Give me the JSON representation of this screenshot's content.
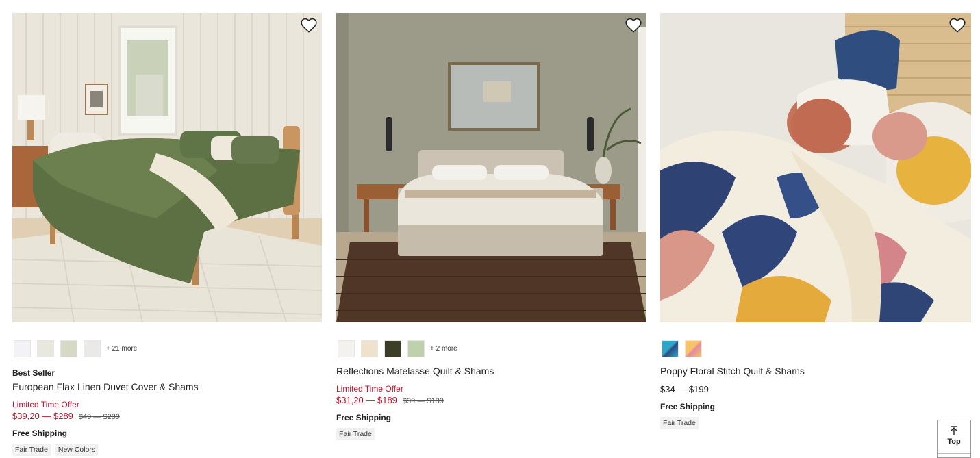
{
  "products": [
    {
      "name": "European Flax Linen Duvet Cover & Shams",
      "badge": "Best Seller",
      "swatches": [
        "#f3f3f7",
        "#e8e8df",
        "#d7d8c5",
        "#ebe9e7"
      ],
      "more_colors": "+ 21 more",
      "offer": "Limited Time Offer",
      "sale_price": "$39,20 — $289",
      "regular_price": "$49 — $289",
      "shipping": "Free Shipping",
      "tags": [
        "Fair Trade",
        "New Colors"
      ]
    },
    {
      "name": "Reflections Matelasse Quilt & Shams",
      "swatches": [
        "#f4f2ee",
        "#efe2cc",
        "#3d3e28",
        "#bfd0ad"
      ],
      "more_colors": "+ 2 more",
      "offer": "Limited Time Offer",
      "sale_price": "$31,20 — $189",
      "regular_price": "$39 — $189",
      "shipping": "Free Shipping",
      "tags": [
        "Fair Trade"
      ]
    },
    {
      "name": "Poppy Floral Stitch Quilt & Shams",
      "swatches": [
        "#2fa6c7",
        "#f5c466"
      ],
      "price": "$34 — $199",
      "shipping": "Free Shipping",
      "tags": [
        "Fair Trade"
      ]
    }
  ],
  "scroll_top": {
    "label": "Top"
  },
  "colors": {
    "sale_red": "#c8102e",
    "tag_bg": "#f1f1f1"
  },
  "icons": {
    "favorite": "heart-icon",
    "scroll_top": "arrow-up-icon"
  }
}
